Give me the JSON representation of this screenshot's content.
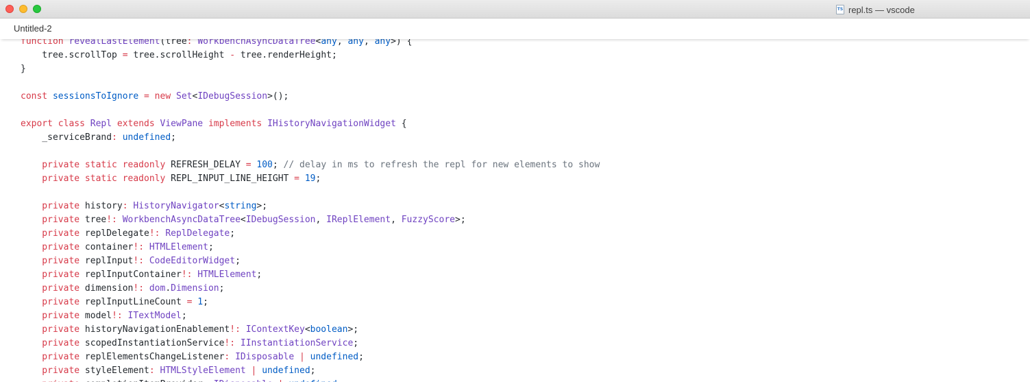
{
  "window": {
    "title": "repl.ts — vscode",
    "file_icon": "typescript-file-icon"
  },
  "tab": {
    "label": "Untitled-2"
  },
  "colors": {
    "keyword": "#d73a49",
    "type": "#6f42c1",
    "constant": "#005cc5",
    "comment": "#6a737d",
    "text": "#24292e"
  },
  "code_lines": [
    [
      [
        "k",
        "function "
      ],
      [
        "t",
        "revealLastElement"
      ],
      [
        "p",
        "(tree"
      ],
      [
        "k",
        ": "
      ],
      [
        "t",
        "WorkbenchAsyncDataTree"
      ],
      [
        "p",
        "<"
      ],
      [
        "c",
        "any"
      ],
      [
        "p",
        ", "
      ],
      [
        "c",
        "any"
      ],
      [
        "p",
        ", "
      ],
      [
        "c",
        "any"
      ],
      [
        "p",
        ">) {"
      ]
    ],
    [
      [
        "p",
        "    tree.scrollTop "
      ],
      [
        "k",
        "="
      ],
      [
        "p",
        " tree.scrollHeight "
      ],
      [
        "k",
        "-"
      ],
      [
        "p",
        " tree.renderHeight;"
      ]
    ],
    [
      [
        "p",
        "}"
      ]
    ],
    [],
    [
      [
        "k",
        "const "
      ],
      [
        "c",
        "sessionsToIgnore"
      ],
      [
        "k",
        " = new "
      ],
      [
        "t",
        "Set"
      ],
      [
        "p",
        "<"
      ],
      [
        "t",
        "IDebugSession"
      ],
      [
        "p",
        ">();"
      ]
    ],
    [],
    [
      [
        "k",
        "export class "
      ],
      [
        "t",
        "Repl"
      ],
      [
        "k",
        " extends "
      ],
      [
        "t",
        "ViewPane"
      ],
      [
        "k",
        " implements "
      ],
      [
        "t",
        "IHistoryNavigationWidget"
      ],
      [
        "p",
        " {"
      ]
    ],
    [
      [
        "p",
        "    _serviceBrand"
      ],
      [
        "k",
        ": "
      ],
      [
        "c",
        "undefined"
      ],
      [
        "p",
        ";"
      ]
    ],
    [],
    [
      [
        "k",
        "    private static readonly "
      ],
      [
        "p",
        "REFRESH_DELAY "
      ],
      [
        "k",
        "="
      ],
      [
        "p",
        " "
      ],
      [
        "c",
        "100"
      ],
      [
        "p",
        "; "
      ],
      [
        "cm",
        "// delay in ms to refresh the repl for new elements to show"
      ]
    ],
    [
      [
        "k",
        "    private static readonly "
      ],
      [
        "p",
        "REPL_INPUT_LINE_HEIGHT "
      ],
      [
        "k",
        "="
      ],
      [
        "p",
        " "
      ],
      [
        "c",
        "19"
      ],
      [
        "p",
        ";"
      ]
    ],
    [],
    [
      [
        "k",
        "    private "
      ],
      [
        "p",
        "history"
      ],
      [
        "k",
        ": "
      ],
      [
        "t",
        "HistoryNavigator"
      ],
      [
        "p",
        "<"
      ],
      [
        "c",
        "string"
      ],
      [
        "p",
        ">;"
      ]
    ],
    [
      [
        "k",
        "    private "
      ],
      [
        "p",
        "tree"
      ],
      [
        "k",
        "!: "
      ],
      [
        "t",
        "WorkbenchAsyncDataTree"
      ],
      [
        "p",
        "<"
      ],
      [
        "t",
        "IDebugSession"
      ],
      [
        "p",
        ", "
      ],
      [
        "t",
        "IReplElement"
      ],
      [
        "p",
        ", "
      ],
      [
        "t",
        "FuzzyScore"
      ],
      [
        "p",
        ">;"
      ]
    ],
    [
      [
        "k",
        "    private "
      ],
      [
        "p",
        "replDelegate"
      ],
      [
        "k",
        "!: "
      ],
      [
        "t",
        "ReplDelegate"
      ],
      [
        "p",
        ";"
      ]
    ],
    [
      [
        "k",
        "    private "
      ],
      [
        "p",
        "container"
      ],
      [
        "k",
        "!: "
      ],
      [
        "t",
        "HTMLElement"
      ],
      [
        "p",
        ";"
      ]
    ],
    [
      [
        "k",
        "    private "
      ],
      [
        "p",
        "replInput"
      ],
      [
        "k",
        "!: "
      ],
      [
        "t",
        "CodeEditorWidget"
      ],
      [
        "p",
        ";"
      ]
    ],
    [
      [
        "k",
        "    private "
      ],
      [
        "p",
        "replInputContainer"
      ],
      [
        "k",
        "!: "
      ],
      [
        "t",
        "HTMLElement"
      ],
      [
        "p",
        ";"
      ]
    ],
    [
      [
        "k",
        "    private "
      ],
      [
        "p",
        "dimension"
      ],
      [
        "k",
        "!: "
      ],
      [
        "t",
        "dom"
      ],
      [
        "p",
        "."
      ],
      [
        "t",
        "Dimension"
      ],
      [
        "p",
        ";"
      ]
    ],
    [
      [
        "k",
        "    private "
      ],
      [
        "p",
        "replInputLineCount "
      ],
      [
        "k",
        "="
      ],
      [
        "p",
        " "
      ],
      [
        "c",
        "1"
      ],
      [
        "p",
        ";"
      ]
    ],
    [
      [
        "k",
        "    private "
      ],
      [
        "p",
        "model"
      ],
      [
        "k",
        "!: "
      ],
      [
        "t",
        "ITextModel"
      ],
      [
        "p",
        ";"
      ]
    ],
    [
      [
        "k",
        "    private "
      ],
      [
        "p",
        "historyNavigationEnablement"
      ],
      [
        "k",
        "!: "
      ],
      [
        "t",
        "IContextKey"
      ],
      [
        "p",
        "<"
      ],
      [
        "c",
        "boolean"
      ],
      [
        "p",
        ">;"
      ]
    ],
    [
      [
        "k",
        "    private "
      ],
      [
        "p",
        "scopedInstantiationService"
      ],
      [
        "k",
        "!: "
      ],
      [
        "t",
        "IInstantiationService"
      ],
      [
        "p",
        ";"
      ]
    ],
    [
      [
        "k",
        "    private "
      ],
      [
        "p",
        "replElementsChangeListener"
      ],
      [
        "k",
        ": "
      ],
      [
        "t",
        "IDisposable"
      ],
      [
        "k",
        " | "
      ],
      [
        "c",
        "undefined"
      ],
      [
        "p",
        ";"
      ]
    ],
    [
      [
        "k",
        "    private "
      ],
      [
        "p",
        "styleElement"
      ],
      [
        "k",
        ": "
      ],
      [
        "t",
        "HTMLStyleElement"
      ],
      [
        "k",
        " | "
      ],
      [
        "c",
        "undefined"
      ],
      [
        "p",
        ";"
      ]
    ],
    [
      [
        "k",
        "    private "
      ],
      [
        "p",
        "completionItemProvider"
      ],
      [
        "k",
        ": "
      ],
      [
        "t",
        "IDisposable"
      ],
      [
        "k",
        " | "
      ],
      [
        "c",
        "undefined"
      ],
      [
        "p",
        ";"
      ]
    ]
  ]
}
